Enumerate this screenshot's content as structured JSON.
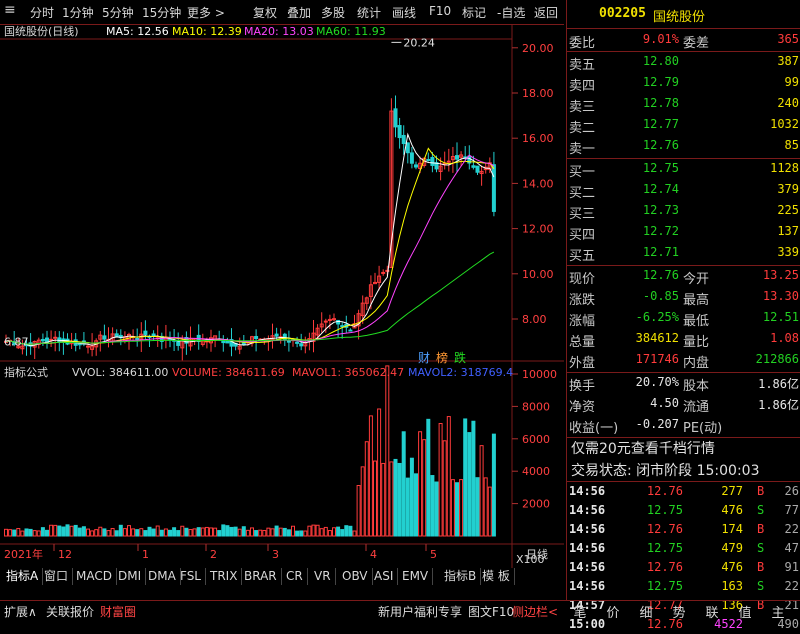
{
  "menu": {
    "left_items": [
      "分时",
      "1分钟",
      "5分钟",
      "15分钟",
      "更多 >"
    ],
    "right_items": [
      "复权",
      "叠加",
      "多股",
      "统计",
      "画线",
      "F10",
      "标记",
      "-自选",
      "返回"
    ]
  },
  "stock": {
    "code": "002205",
    "name": "国统股份"
  },
  "chart_header": {
    "title": "国统股份(日线)",
    "ma5": "MA5: 12.56",
    "ma10": "MA10: 12.39",
    "ma20": "MA20: 13.03",
    "ma60": "MA60: 11.93"
  },
  "price_axis": [
    "20.00",
    "18.00",
    "16.00",
    "14.00",
    "12.00",
    "10.00",
    "8.00"
  ],
  "price_marks": {
    "high": "20.24",
    "low": "6.87"
  },
  "badges": [
    "财",
    "榜",
    "跌"
  ],
  "indicator_header": {
    "title": "指标公式",
    "vol": "VVOL: 384611.00",
    "volume": "VOLUME: 384611.69",
    "mavol1": "MAVOL1: 365062.47",
    "mavol2": "MAVOL2: 318769.4"
  },
  "volume_axis": [
    "10000",
    "8000",
    "6000",
    "4000",
    "2000"
  ],
  "volume_unit": "X100",
  "date_axis": {
    "year": "2021年",
    "labels": [
      "12",
      "1",
      "2",
      "3",
      "4",
      "5"
    ],
    "period": "日线"
  },
  "colors": {
    "red": "#ff3b3b",
    "green": "#22d022",
    "yellow": "#f0e000",
    "white": "#e6e6e6",
    "magenta": "#ff44ff",
    "ma5": "#ffffff",
    "ma10": "#ffff00",
    "ma20": "#ff44ff",
    "ma60": "#22dd22"
  },
  "quote": {
    "weibi": {
      "l": "委比",
      "v": "9.01%",
      "l2": "委差",
      "v2": "365"
    },
    "asks": [
      {
        "l": "卖五",
        "p": "12.80",
        "v": "387"
      },
      {
        "l": "卖四",
        "p": "12.79",
        "v": "99"
      },
      {
        "l": "卖三",
        "p": "12.78",
        "v": "240"
      },
      {
        "l": "卖二",
        "p": "12.77",
        "v": "1032"
      },
      {
        "l": "卖一",
        "p": "12.76",
        "v": "85"
      }
    ],
    "bids": [
      {
        "l": "买一",
        "p": "12.75",
        "v": "1128"
      },
      {
        "l": "买二",
        "p": "12.74",
        "v": "379"
      },
      {
        "l": "买三",
        "p": "12.73",
        "v": "225"
      },
      {
        "l": "买四",
        "p": "12.72",
        "v": "137"
      },
      {
        "l": "买五",
        "p": "12.71",
        "v": "339"
      }
    ],
    "stats": [
      {
        "l": "现价",
        "v": "12.76",
        "l2": "今开",
        "v2": "13.25"
      },
      {
        "l": "涨跌",
        "v": "-0.85",
        "l2": "最高",
        "v2": "13.30"
      },
      {
        "l": "涨幅",
        "v": "-6.25%",
        "l2": "最低",
        "v2": "12.51"
      },
      {
        "l": "总量",
        "v": "384612",
        "l2": "量比",
        "v2": "1.08"
      },
      {
        "l": "外盘",
        "v": "171746",
        "l2": "内盘",
        "v2": "212866"
      }
    ],
    "stats2": [
      {
        "l": "换手",
        "v": "20.70%",
        "l2": "股本",
        "v2": "1.86亿"
      },
      {
        "l": "净资",
        "v": "4.50",
        "l2": "流通",
        "v2": "1.86亿"
      },
      {
        "l": "收益(一)",
        "v": "-0.207",
        "l2": "PE(动)",
        "v2": ""
      }
    ],
    "promo": "仅需20元查看千档行情",
    "trade_status": "交易状态: 闭市阶段 15:00:03",
    "ticks": [
      {
        "t": "14:56",
        "p": "12.76",
        "v": "277",
        "f": "B",
        "n": "26"
      },
      {
        "t": "14:56",
        "p": "12.75",
        "v": "476",
        "f": "S",
        "n": "77"
      },
      {
        "t": "14:56",
        "p": "12.76",
        "v": "174",
        "f": "B",
        "n": "22"
      },
      {
        "t": "14:56",
        "p": "12.75",
        "v": "479",
        "f": "S",
        "n": "47"
      },
      {
        "t": "14:56",
        "p": "12.76",
        "v": "476",
        "f": "B",
        "n": "91"
      },
      {
        "t": "14:56",
        "p": "12.75",
        "v": "163",
        "f": "S",
        "n": "22"
      },
      {
        "t": "14:57",
        "p": "12.77",
        "v": "136",
        "f": "B",
        "n": "21"
      },
      {
        "t": "15:00",
        "p": "12.76",
        "v": "4522",
        "f": "",
        "n": "490"
      }
    ]
  },
  "indicator_tabs": [
    "指标A",
    "窗口",
    "MACD",
    "DMI",
    "DMA",
    "FSL",
    "TRIX",
    "BRAR",
    "CR",
    "VR",
    "OBV",
    "ASI",
    "EMV"
  ],
  "indicator_tabs_right": [
    "指标B",
    "模 板"
  ],
  "status_bar": {
    "left": [
      "扩展∧",
      "关联报价",
      "财富圈"
    ],
    "promo": "新用户福利专享",
    "chart_btn": "图文F10",
    "side_btn": "侧边栏<"
  },
  "right_tabs": [
    "笔",
    "价",
    "细",
    "势",
    "联",
    "值",
    "主"
  ]
}
